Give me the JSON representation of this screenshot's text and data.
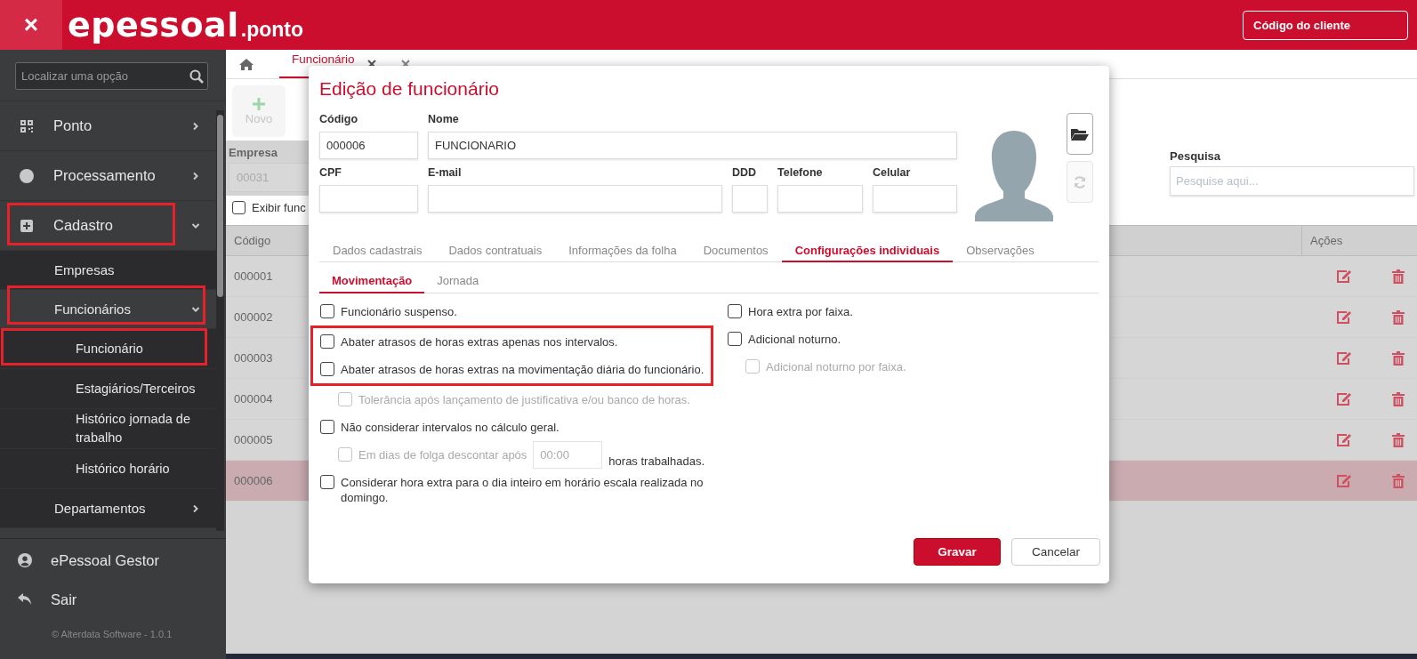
{
  "header": {
    "close_label": "×",
    "logo": {
      "brand": "epessoal",
      "suffix": ".ponto"
    },
    "client_button": "Código do cliente"
  },
  "sidebar": {
    "search_placeholder": "Localizar uma opção",
    "items": [
      {
        "label": "Ponto",
        "expanded": false,
        "highlighted": false
      },
      {
        "label": "Processamento",
        "expanded": false,
        "highlighted": false
      },
      {
        "label": "Cadastro",
        "expanded": true,
        "highlighted": true,
        "children": [
          {
            "label": "Empresas",
            "highlighted": false
          },
          {
            "label": "Funcionários",
            "expanded": true,
            "highlighted": true,
            "children": [
              {
                "label": "Funcionário",
                "highlighted": true
              },
              {
                "label": "Estagiários/Terceiros",
                "highlighted": false
              },
              {
                "label": "Histórico jornada de trabalho",
                "highlighted": false
              },
              {
                "label": "Histórico horário",
                "highlighted": false
              }
            ]
          },
          {
            "label": "Departamentos",
            "expanded": false,
            "highlighted": false
          }
        ]
      }
    ],
    "footer_items": [
      {
        "label": "ePessoal Gestor"
      },
      {
        "label": "Sair"
      }
    ],
    "copyright": "© Alterdata Software - 1.0.1"
  },
  "main": {
    "tabs": [
      {
        "label": "Funcionário",
        "selected": true
      }
    ],
    "new_button": {
      "label": "Novo",
      "disabled": true
    },
    "company": {
      "label": "Empresa",
      "value": "00031",
      "disabled": true
    },
    "search": {
      "label": "Pesquisa",
      "placeholder": "Pesquise aqui..."
    },
    "show_checkbox": {
      "label": "Exibir func",
      "checked": false
    },
    "table": {
      "columns": [
        "Código",
        "Ações"
      ],
      "rows": [
        {
          "code": "000001",
          "selected": false
        },
        {
          "code": "000002",
          "selected": false
        },
        {
          "code": "000003",
          "selected": false
        },
        {
          "code": "000004",
          "selected": false
        },
        {
          "code": "000005",
          "selected": false
        },
        {
          "code": "000006",
          "selected": true
        }
      ]
    }
  },
  "modal": {
    "title": "Edição de funcionário",
    "field_rows": [
      [
        {
          "label": "Código",
          "value": "000006"
        },
        {
          "label": "Nome",
          "value": "FUNCIONARIO"
        }
      ],
      [
        {
          "label": "CPF"
        },
        {
          "label": "E-mail"
        },
        {
          "label": "DDD"
        },
        {
          "label": "Telefone"
        },
        {
          "label": "Celular"
        }
      ]
    ],
    "photo_actions": [
      {
        "kind": "folder",
        "disabled": false
      },
      {
        "kind": "refresh",
        "disabled": true
      }
    ],
    "tabs": [
      {
        "label": "Dados cadastrais",
        "selected": false
      },
      {
        "label": "Dados contratuais",
        "selected": false
      },
      {
        "label": "Informações da folha",
        "selected": false
      },
      {
        "label": "Documentos",
        "selected": false
      },
      {
        "label": "Configurações individuais",
        "selected": true
      },
      {
        "label": "Observações",
        "selected": false
      }
    ],
    "subtabs": [
      {
        "label": "Movimentação",
        "selected": true
      },
      {
        "label": "Jornada",
        "selected": false
      }
    ],
    "options": {
      "left": [
        {
          "kind": "check",
          "label": "Funcionário suspenso.",
          "checked": false,
          "disabled": false,
          "highlighted": false
        },
        {
          "kind": "check",
          "label": "Abater atrasos de horas extras apenas nos intervalos.",
          "checked": false,
          "disabled": false,
          "highlighted": true
        },
        {
          "kind": "check",
          "label": "Abater atrasos de horas extras na movimentação diária do funcionário.",
          "checked": false,
          "disabled": false,
          "highlighted": true,
          "children": [
            {
              "kind": "check",
              "label": "Tolerância após lançamento de justificativa e/ou banco de horas.",
              "checked": false,
              "disabled": true
            }
          ]
        },
        {
          "kind": "check",
          "label": "Não considerar intervalos no cálculo geral.",
          "checked": false,
          "disabled": false,
          "highlighted": false,
          "children": [
            {
              "kind": "time",
              "label": "Em dias de folga descontar após",
              "value": "00:00",
              "suffix": "horas trabalhadas.",
              "checked": false,
              "disabled": true
            }
          ]
        },
        {
          "kind": "check",
          "label": "Considerar hora extra para o dia inteiro em horário escala realizada no domingo.",
          "checked": false,
          "disabled": false,
          "highlighted": false
        }
      ],
      "right": [
        {
          "kind": "check",
          "label": "Hora extra por faixa.",
          "checked": false,
          "disabled": false,
          "highlighted": false
        },
        {
          "kind": "check",
          "label": "Adicional noturno.",
          "checked": false,
          "disabled": false,
          "highlighted": false,
          "children": [
            {
              "kind": "check",
              "label": "Adicional noturno por faixa.",
              "checked": false,
              "disabled": true
            }
          ]
        }
      ]
    },
    "buttons": [
      {
        "label": "Gravar",
        "kind": "primary"
      },
      {
        "label": "Cancelar",
        "kind": "secondary"
      }
    ]
  }
}
